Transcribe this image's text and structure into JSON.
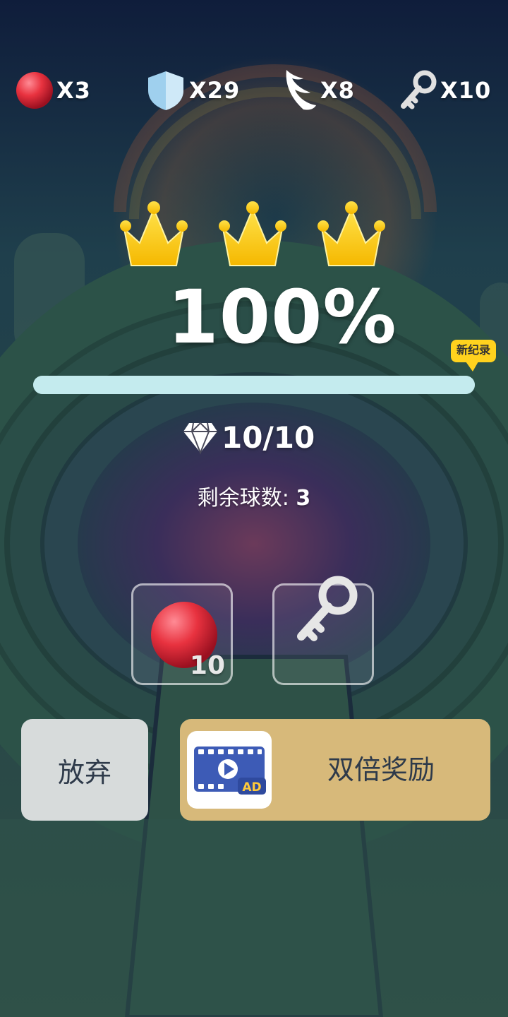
{
  "hud": {
    "balls": "X3",
    "shields": "X29",
    "wings": "X8",
    "keys": "X10"
  },
  "result": {
    "crowns_earned": 3,
    "percent": "100%",
    "progress_fraction": 1.0,
    "record_badge": "新纪录",
    "gems": "10/10",
    "balls_left_label": "剩余球数:",
    "balls_left_value": "3"
  },
  "slots": {
    "ball_count": "10"
  },
  "buttons": {
    "give_up": "放弃",
    "double_reward": "双倍奖励",
    "ad_badge": "AD"
  },
  "colors": {
    "crown": "#ffd21e",
    "progress": "#c4ebee",
    "double_button": "#d7b97a",
    "give_up_button": "#d7dbdb",
    "ball": "#e83a4a"
  }
}
